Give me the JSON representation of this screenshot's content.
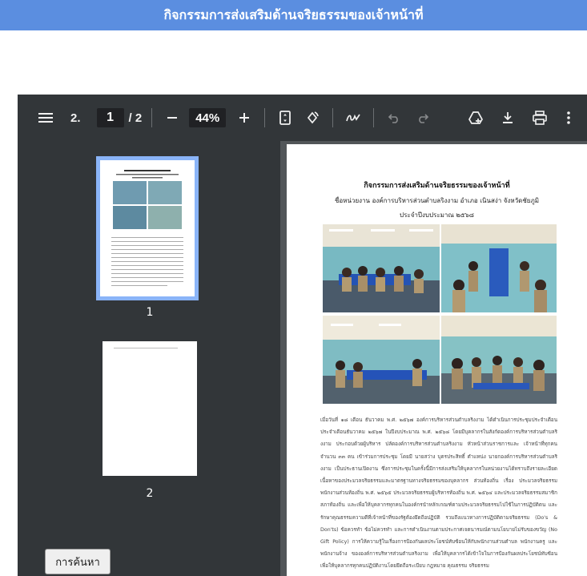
{
  "banner": {
    "title": "กิจกรรมการส่งเสริมด้านจริยธรรมของเจ้าหน้าที่"
  },
  "toolbar": {
    "current_page": "1",
    "total_pages": "/ 2",
    "zoom": "44%",
    "title_fragment": "2.",
    "icons": [
      "menu-icon",
      "zoom-out-icon",
      "zoom-in-icon",
      "fit-page-icon",
      "rotate-icon",
      "annotate-icon",
      "undo-icon",
      "redo-icon",
      "drive-icon",
      "download-icon",
      "print-icon",
      "more-icon"
    ]
  },
  "sidebar": {
    "thumbnails": [
      {
        "label": "1",
        "selected": true
      },
      {
        "label": "2",
        "selected": false
      }
    ]
  },
  "document": {
    "title": "กิจกรรมการส่งเสริมด้านจริยธรรมของเจ้าหน้าที่",
    "agency": "ชื่อหน่วยงาน องค์การบริหารส่วนตำบลริงงาม อำเภอ เนินสง่า จังหวัดชัยภูมิ",
    "fiscal_year": "ประจำปีงบประมาณ ๒๕๖๘",
    "body": "เมื่อวันที่ ๑๘ เดือน ธันวาคม พ.ศ. ๒๕๖๗ องค์การบริหารส่วนตำบลริงงาม ได้ดำเนินการประชุมประจำเดือนประจำเดือนธันวาคม ๒๕๖๗ ในปีงบประมาณ พ.ศ. ๒๕๖๘ โดยมีบุคลากรในสังกัดองค์การบริหารส่วนตำบลริงงาม ประกอบด้วยผู้บริหาร ปลัดองค์การบริหารส่วนตำบลริงงาม หัวหน้าส่วนราชการและ เจ้าหน้าที่ทุกคนจำนวน ๓๓ คน เข้าร่วมการประชุม โดยมี นายสว่าง บุตรประสิทธิ์ ตำแหน่ง นายกองค์การบริหารส่วนตำบลริงงาม เป็นประธานเปิดงาน ซึ่งการประชุมในครั้งนี้มีการส่งเสริมให้บุคลากรในหน่วยงานได้ทราบถึงรายละเอียดเนื้อหาของประมวลจริยธรรมและมาตรฐานทางจริยธรรมของบุคลากร ส่วนท้องถิ่น เรื่อง ประมวลจริยธรรมพนักงานส่วนท้องถิ่น พ.ศ. ๒๕๖๕ ประมวลจริยธรรมผู้บริหารท้องถิ่น พ.ศ. ๒๕๖๔ และประมวลจริยธรรมสมาชิกสภาท้องถิ่น และเพื่อให้บุคลากรทุกคนในองค์กรนำหลักเกณฑ์ตามประมวลจริยธรรมไปใช้ในการปฏิบัติตน และรักษาคุณธรรมความดีที่เจ้าหน้าที่ของรัฐต้องยึดถือปฏิบัติ รวมถึงแนวทางการปฏิบัติตามจริยธรรม (Do's & Don'ts) ข้อควรทำ ข้อไม่ควรทำ และการดำเนินงานตามประกาศเจตนารมณ์ตามนโยบายไม่รับของขวัญ (No Gift Policy) การให้ความรู้ในเรื่องการป้องกันผลประโยชน์ทับซ้อนให้กับพนักงานส่วนตำบล พนักงานครู และพนักงานจ้าง ขององค์การบริหารส่วนตำบลริงงาม เพื่อให้บุคลากรได้เข้าใจในการป้องกันผลประโยชน์ทับซ้อน เพื่อให้บุคลากรทุกคนปฏิบัติงานโดยยึดถือระเบียบ กฎหมาย คุณธรรม จริยธรรม"
  },
  "search_button": {
    "label": "การค้นหา"
  }
}
